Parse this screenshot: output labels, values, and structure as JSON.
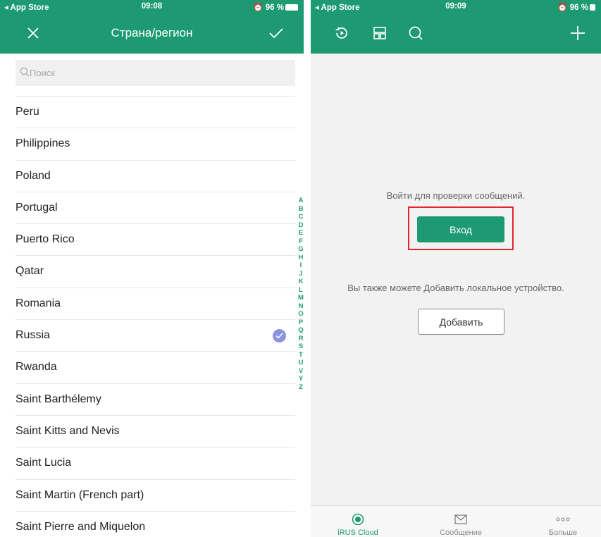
{
  "left_screen": {
    "status": {
      "carrier": "◂ App Store",
      "time": "09:08",
      "battery": "96 %"
    },
    "title": "Страна/регион",
    "search": {
      "placeholder": "Поиск"
    },
    "countries": [
      {
        "name": "Peru",
        "selected": false
      },
      {
        "name": "Philippines",
        "selected": false
      },
      {
        "name": "Poland",
        "selected": false
      },
      {
        "name": "Portugal",
        "selected": false
      },
      {
        "name": "Puerto Rico",
        "selected": false
      },
      {
        "name": "Qatar",
        "selected": false
      },
      {
        "name": "Romania",
        "selected": false
      },
      {
        "name": "Russia",
        "selected": true
      },
      {
        "name": "Rwanda",
        "selected": false
      },
      {
        "name": "Saint Barthélemy",
        "selected": false
      },
      {
        "name": "Saint Kitts and Nevis",
        "selected": false
      },
      {
        "name": "Saint Lucia",
        "selected": false
      },
      {
        "name": "Saint Martin (French part)",
        "selected": false
      },
      {
        "name": "Saint Pierre and Miquelon",
        "selected": false
      }
    ],
    "alphabet": [
      "A",
      "B",
      "C",
      "D",
      "E",
      "F",
      "G",
      "H",
      "I",
      "J",
      "K",
      "L",
      "M",
      "N",
      "O",
      "P",
      "Q",
      "R",
      "S",
      "T",
      "U",
      "V",
      "Y",
      "Z"
    ],
    "colors": {
      "accent": "#1d9a72",
      "check": "#8a93e0"
    }
  },
  "right_screen": {
    "status": {
      "carrier": "◂ App Store",
      "time": "09:09",
      "battery": "96 %"
    },
    "message": "Войти для проверки сообщений.",
    "login_button": "Вход",
    "also_text": "Вы также можете Добавить локальное устройство.",
    "add_button": "Добавить",
    "tabs": [
      {
        "label": "iRUS Cloud",
        "icon": "cloud-dot-icon",
        "active": true
      },
      {
        "label": "Сообщение",
        "icon": "envelope-icon",
        "active": false
      },
      {
        "label": "Больше",
        "icon": "more-dots-icon",
        "active": false
      }
    ],
    "colors": {
      "accent": "#1d9a72",
      "highlight": "#e4262a"
    }
  }
}
